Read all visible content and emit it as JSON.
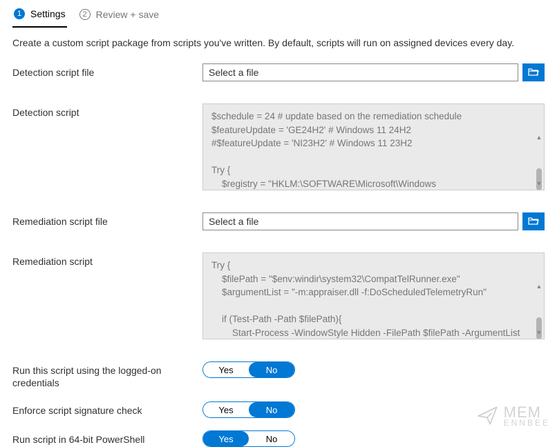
{
  "tabs": {
    "step1": {
      "num": "1",
      "label": "Settings"
    },
    "step2": {
      "num": "2",
      "label": "Review + save"
    }
  },
  "description": "Create a custom script package from scripts you've written. By default, scripts will run on assigned devices every day.",
  "labels": {
    "detection_file": "Detection script file",
    "detection_script": "Detection script",
    "remediation_file": "Remediation script file",
    "remediation_script": "Remediation script",
    "run_logged_on": "Run this script using the logged-on credentials",
    "enforce_sig": "Enforce script signature check",
    "run_64bit": "Run script in 64-bit PowerShell"
  },
  "file_placeholder": "Select a file",
  "toggle": {
    "yes": "Yes",
    "no": "No"
  },
  "toggles": {
    "run_logged_on": "No",
    "enforce_sig": "No",
    "run_64bit": "Yes"
  },
  "scripts": {
    "detection": "$schedule = 24 # update based on the remediation schedule\n$featureUpdate = 'GE24H2' # Windows 11 24H2\n#$featureUpdate = 'NI23H2' # Windows 11 23H2\n\nTry {\n    $registry = \"HKLM:\\SOFTWARE\\Microsoft\\Windows NT\\CurrentVersion\\AppCompatFlags\\CompatMarkers\\$featureUpdate\"",
    "remediation": "Try {\n    $filePath = \"$env:windir\\system32\\CompatTelRunner.exe\"\n    $argumentList = \"-m:appraiser.dll -f:DoScheduledTelemetryRun\"\n\n    if (Test-Path -Path $filePath){\n        Start-Process -WindowStyle Hidden -FilePath $filePath -ArgumentList $argumentList -Wait"
  },
  "watermark": {
    "line1": "MEM",
    "line2": "ENNBEE"
  }
}
